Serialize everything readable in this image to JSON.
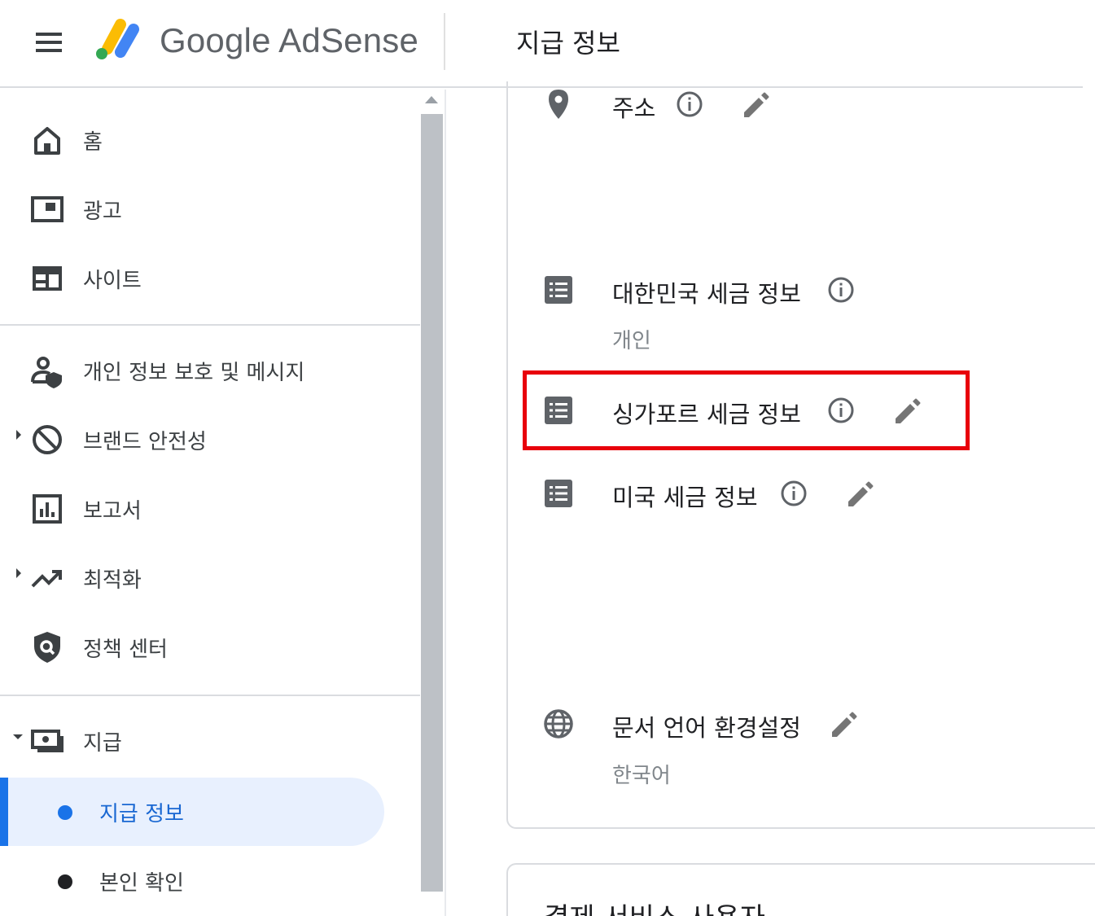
{
  "header": {
    "menu_icon": "hamburger-menu-icon",
    "brand": "Google AdSense",
    "page_title": "지급 정보",
    "logo_colors": [
      "#fbbc04",
      "#34a853",
      "#4285f4"
    ]
  },
  "sidebar": {
    "items": [
      {
        "label": "홈",
        "icon": "home-icon"
      },
      {
        "label": "광고",
        "icon": "ads-icon"
      },
      {
        "label": "사이트",
        "icon": "sites-icon"
      },
      {
        "label": "개인 정보 보호 및 메시지",
        "icon": "privacy-messaging-icon"
      },
      {
        "label": "브랜드 안전성",
        "icon": "block-icon"
      },
      {
        "label": "보고서",
        "icon": "reports-icon"
      },
      {
        "label": "최적화",
        "icon": "trending-up-icon"
      },
      {
        "label": "정책 센터",
        "icon": "policy-shield-icon"
      },
      {
        "label": "지급",
        "icon": "payments-icon"
      }
    ],
    "sub_items": [
      {
        "label": "지급 정보",
        "active": true
      },
      {
        "label": "본인 확인",
        "active": false
      }
    ],
    "active_color": "#1a73e8"
  },
  "main": {
    "rows": [
      {
        "label": "주소",
        "icon": "location-pin-icon"
      },
      {
        "label": "대한민국 세금 정보",
        "sub": "개인",
        "icon": "list-icon"
      },
      {
        "label": "싱가포르 세금 정보",
        "icon": "list-icon"
      },
      {
        "label": "미국 세금 정보",
        "icon": "list-icon"
      },
      {
        "label": "문서 언어 환경설정",
        "sub": "한국어",
        "icon": "globe-icon"
      }
    ],
    "next_card_title": "결제 서비스 사용자",
    "highlight_color": "#e8000b"
  }
}
